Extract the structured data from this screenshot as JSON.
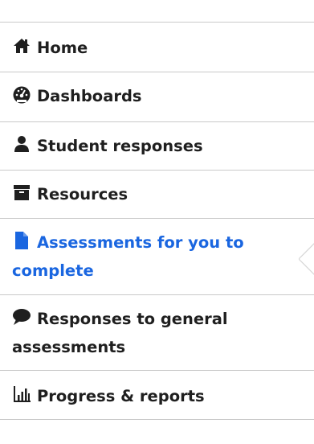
{
  "nav": {
    "items": [
      {
        "label": "Home",
        "icon": "home-icon",
        "active": false
      },
      {
        "label": "Dashboards",
        "icon": "dashboard-gauge-icon",
        "active": false
      },
      {
        "label": "Student responses",
        "icon": "user-icon",
        "active": false
      },
      {
        "label": "Resources",
        "icon": "archive-box-icon",
        "active": false
      },
      {
        "label_line1": "Assessments for you to",
        "label_line2": "complete",
        "icon": "document-icon",
        "active": true
      },
      {
        "label_line1": "Responses to general",
        "label_line2": "assessments",
        "icon": "speech-bubble-icon",
        "active": false
      },
      {
        "label": "Progress & reports",
        "icon": "bar-chart-icon",
        "active": false
      }
    ]
  },
  "colors": {
    "text": "#1f1f1f",
    "active": "#1a66e0",
    "divider": "#c9c9c9",
    "notch": "#d6d6d6"
  }
}
